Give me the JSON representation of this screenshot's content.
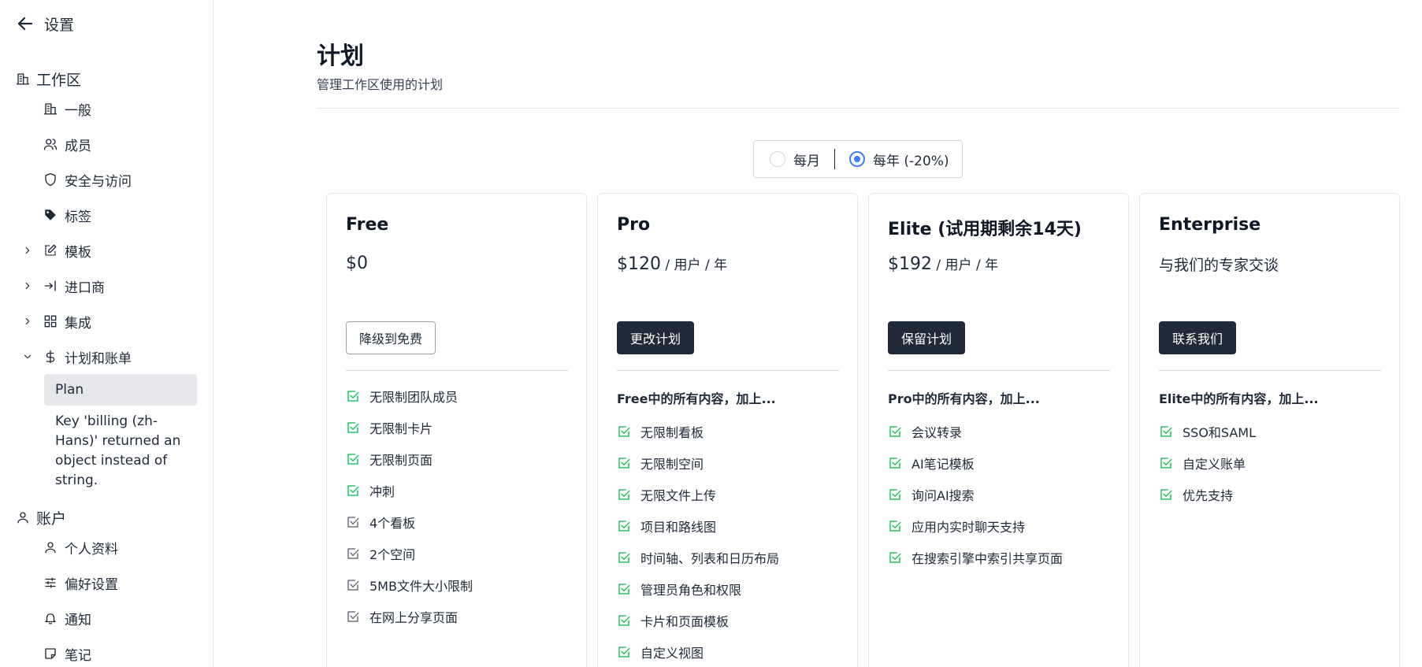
{
  "sidebar": {
    "back_label": "设置",
    "workspace_header": "工作区",
    "workspace_items": [
      {
        "label": "一般"
      },
      {
        "label": "成员"
      },
      {
        "label": "安全与访问"
      },
      {
        "label": "标签"
      },
      {
        "label": "模板"
      },
      {
        "label": "进口商"
      },
      {
        "label": "集成"
      },
      {
        "label": "计划和账单"
      }
    ],
    "billing_sub_active": "Plan",
    "billing_sub_note": "Key 'billing (zh-Hans)' returned an object instead of string.",
    "account_header": "账户",
    "account_items": [
      {
        "label": "个人资料"
      },
      {
        "label": "偏好设置"
      },
      {
        "label": "通知"
      },
      {
        "label": "笔记"
      }
    ]
  },
  "main": {
    "title": "计划",
    "subtitle": "管理工作区使用的计划",
    "billing_period": {
      "monthly": "每月",
      "yearly": "每年 (-20%)",
      "selected": "yearly"
    },
    "plans": [
      {
        "name": "Free",
        "price": "$0",
        "unit": "",
        "button": "降级到免费",
        "features_heading": "",
        "features": [
          {
            "label": "无限制团队成员",
            "included": true
          },
          {
            "label": "无限制卡片",
            "included": true
          },
          {
            "label": "无限制页面",
            "included": true
          },
          {
            "label": "冲刺",
            "included": true
          },
          {
            "label": "4个看板",
            "included": false
          },
          {
            "label": "2个空间",
            "included": false
          },
          {
            "label": "5MB文件大小限制",
            "included": false
          },
          {
            "label": "在网上分享页面",
            "included": false
          }
        ]
      },
      {
        "name": "Pro",
        "price": "$120",
        "unit": " / 用户 / 年",
        "button": "更改计划",
        "features_heading": "Free中的所有内容，加上...",
        "features": [
          {
            "label": "无限制看板",
            "included": true
          },
          {
            "label": "无限制空间",
            "included": true
          },
          {
            "label": "无限文件上传",
            "included": true
          },
          {
            "label": "项目和路线图",
            "included": true
          },
          {
            "label": "时间轴、列表和日历布局",
            "included": true
          },
          {
            "label": "管理员角色和权限",
            "included": true
          },
          {
            "label": "卡片和页面模板",
            "included": true
          },
          {
            "label": "自定义视图",
            "included": true
          }
        ]
      },
      {
        "name": "Elite (试用期剩余14天)",
        "price": "$192",
        "unit": " / 用户 / 年",
        "button": "保留计划",
        "features_heading": "Pro中的所有内容，加上...",
        "features": [
          {
            "label": "会议转录",
            "included": true
          },
          {
            "label": "AI笔记模板",
            "included": true
          },
          {
            "label": "询问AI搜索",
            "included": true
          },
          {
            "label": "应用内实时聊天支持",
            "included": true
          },
          {
            "label": "在搜索引擎中索引共享页面",
            "included": true
          }
        ]
      },
      {
        "name": "Enterprise",
        "price": "与我们的专家交谈",
        "unit": "",
        "button": "联系我们",
        "features_heading": "Elite中的所有内容，加上...",
        "features": [
          {
            "label": "SSO和SAML",
            "included": true
          },
          {
            "label": "自定义账单",
            "included": true
          },
          {
            "label": "优先支持",
            "included": true
          }
        ]
      }
    ]
  },
  "colors": {
    "check_included": "#22c55e",
    "check_excluded": "#6b7280",
    "primary_button": "#1f2937",
    "radio_selected": "#3b82f6",
    "active_nav_bg": "#e5e7eb"
  }
}
